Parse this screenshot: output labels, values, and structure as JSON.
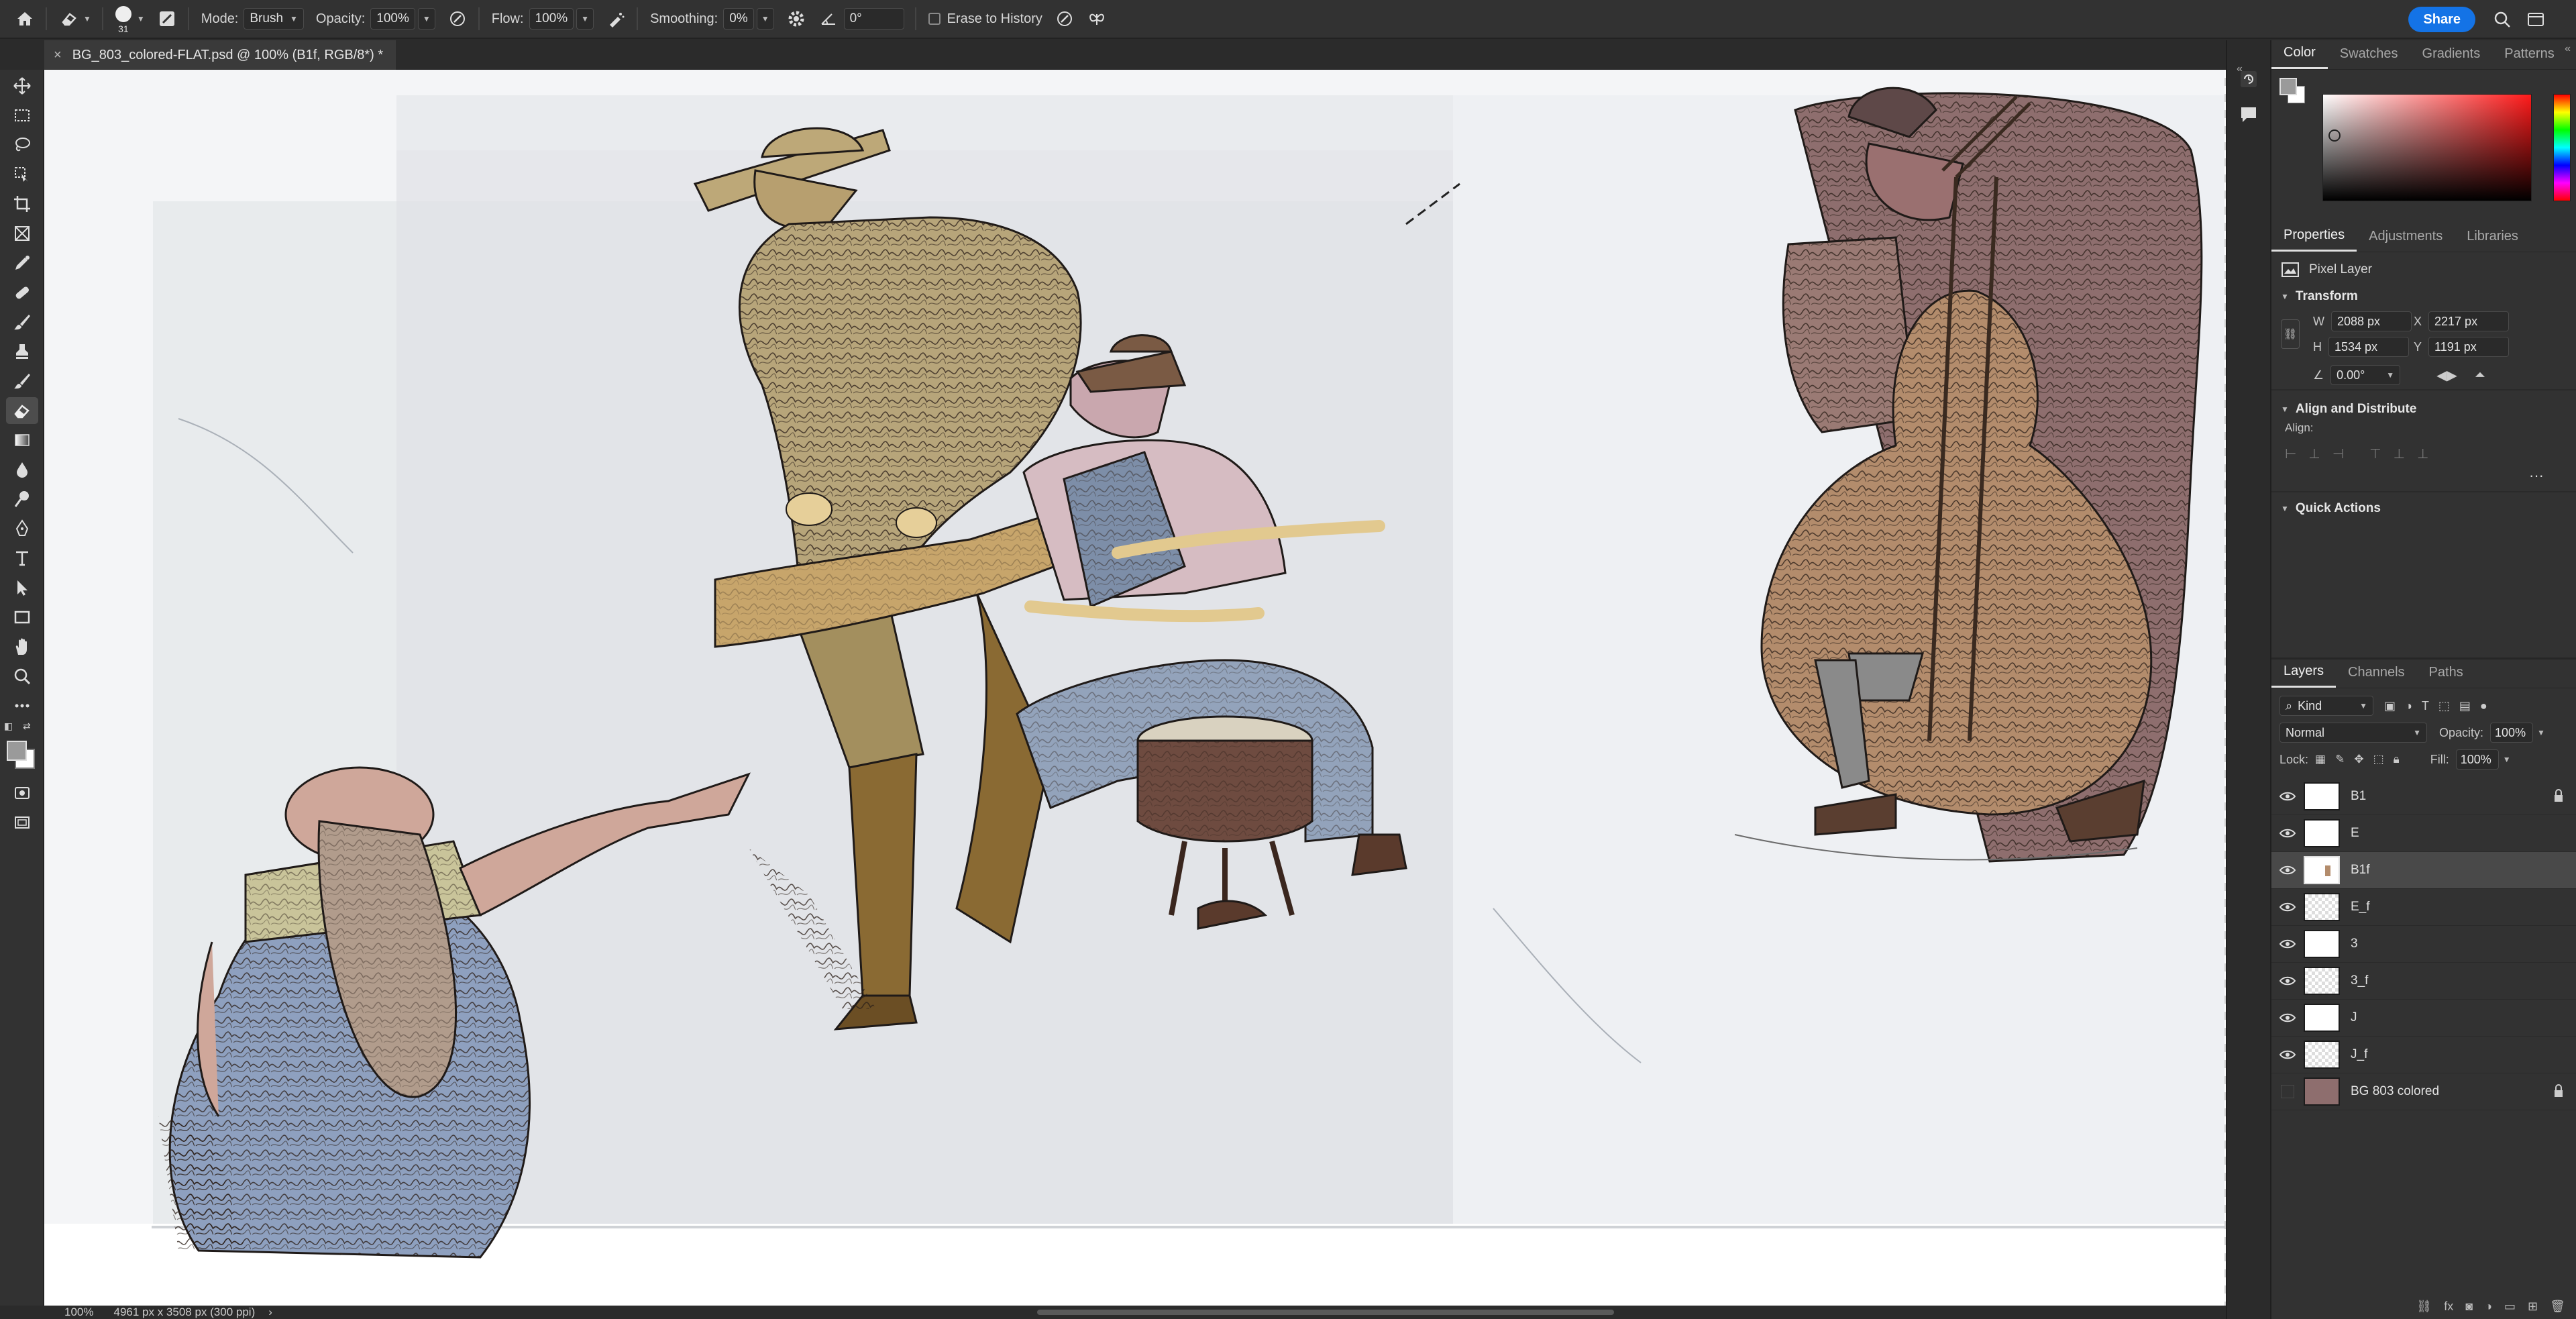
{
  "options_bar": {
    "brush_size": "31",
    "mode_label": "Mode:",
    "mode_value": "Brush",
    "opacity_label": "Opacity:",
    "opacity_value": "100%",
    "flow_label": "Flow:",
    "flow_value": "100%",
    "smoothing_label": "Smoothing:",
    "smoothing_value": "0%",
    "angle_value": "0°",
    "erase_to_history_label": "Erase to History",
    "share_label": "Share"
  },
  "document": {
    "tab_title": "BG_803_colored-FLAT.psd @ 100% (B1f, RGB/8*) *"
  },
  "status_bar": {
    "zoom": "100%",
    "doc_size": "4961 px x 3508 px (300 ppi)"
  },
  "color_panel": {
    "tabs": [
      "Color",
      "Swatches",
      "Gradients",
      "Patterns"
    ],
    "foreground_color": "#9a9a9a",
    "hue_color": "#ff1a1a"
  },
  "properties_panel": {
    "tabs": [
      "Properties",
      "Adjustments",
      "Libraries"
    ],
    "layer_type": "Pixel Layer",
    "transform_title": "Transform",
    "w_label": "W",
    "w_value": "2088 px",
    "h_label": "H",
    "h_value": "1534 px",
    "x_label": "X",
    "x_value": "2217 px",
    "y_label": "Y",
    "y_value": "1191 px",
    "angle_value": "0.00°",
    "align_title": "Align and Distribute",
    "align_label": "Align:",
    "quick_actions_title": "Quick Actions"
  },
  "layers_panel": {
    "tabs": [
      "Layers",
      "Channels",
      "Paths"
    ],
    "filter_kind": "Kind",
    "blend_mode": "Normal",
    "opacity_label": "Opacity:",
    "opacity_value": "100%",
    "lock_label": "Lock:",
    "fill_label": "Fill:",
    "fill_value": "100%",
    "layers": [
      {
        "name": "B1",
        "visible": true,
        "locked": true,
        "selected": false
      },
      {
        "name": "E",
        "visible": true,
        "locked": false,
        "selected": false
      },
      {
        "name": "B1f",
        "visible": true,
        "locked": false,
        "selected": true
      },
      {
        "name": "E_f",
        "visible": true,
        "locked": false,
        "selected": false
      },
      {
        "name": "3",
        "visible": true,
        "locked": false,
        "selected": false
      },
      {
        "name": "3_f",
        "visible": true,
        "locked": false,
        "selected": false
      },
      {
        "name": "J",
        "visible": true,
        "locked": false,
        "selected": false
      },
      {
        "name": "J_f",
        "visible": true,
        "locked": false,
        "selected": false
      },
      {
        "name": "BG 803 colored",
        "visible": false,
        "locked": true,
        "selected": false
      }
    ]
  },
  "colors": {
    "accent": "#1473e6",
    "panel_bg": "#323232",
    "app_bg": "#2b2b2b"
  }
}
